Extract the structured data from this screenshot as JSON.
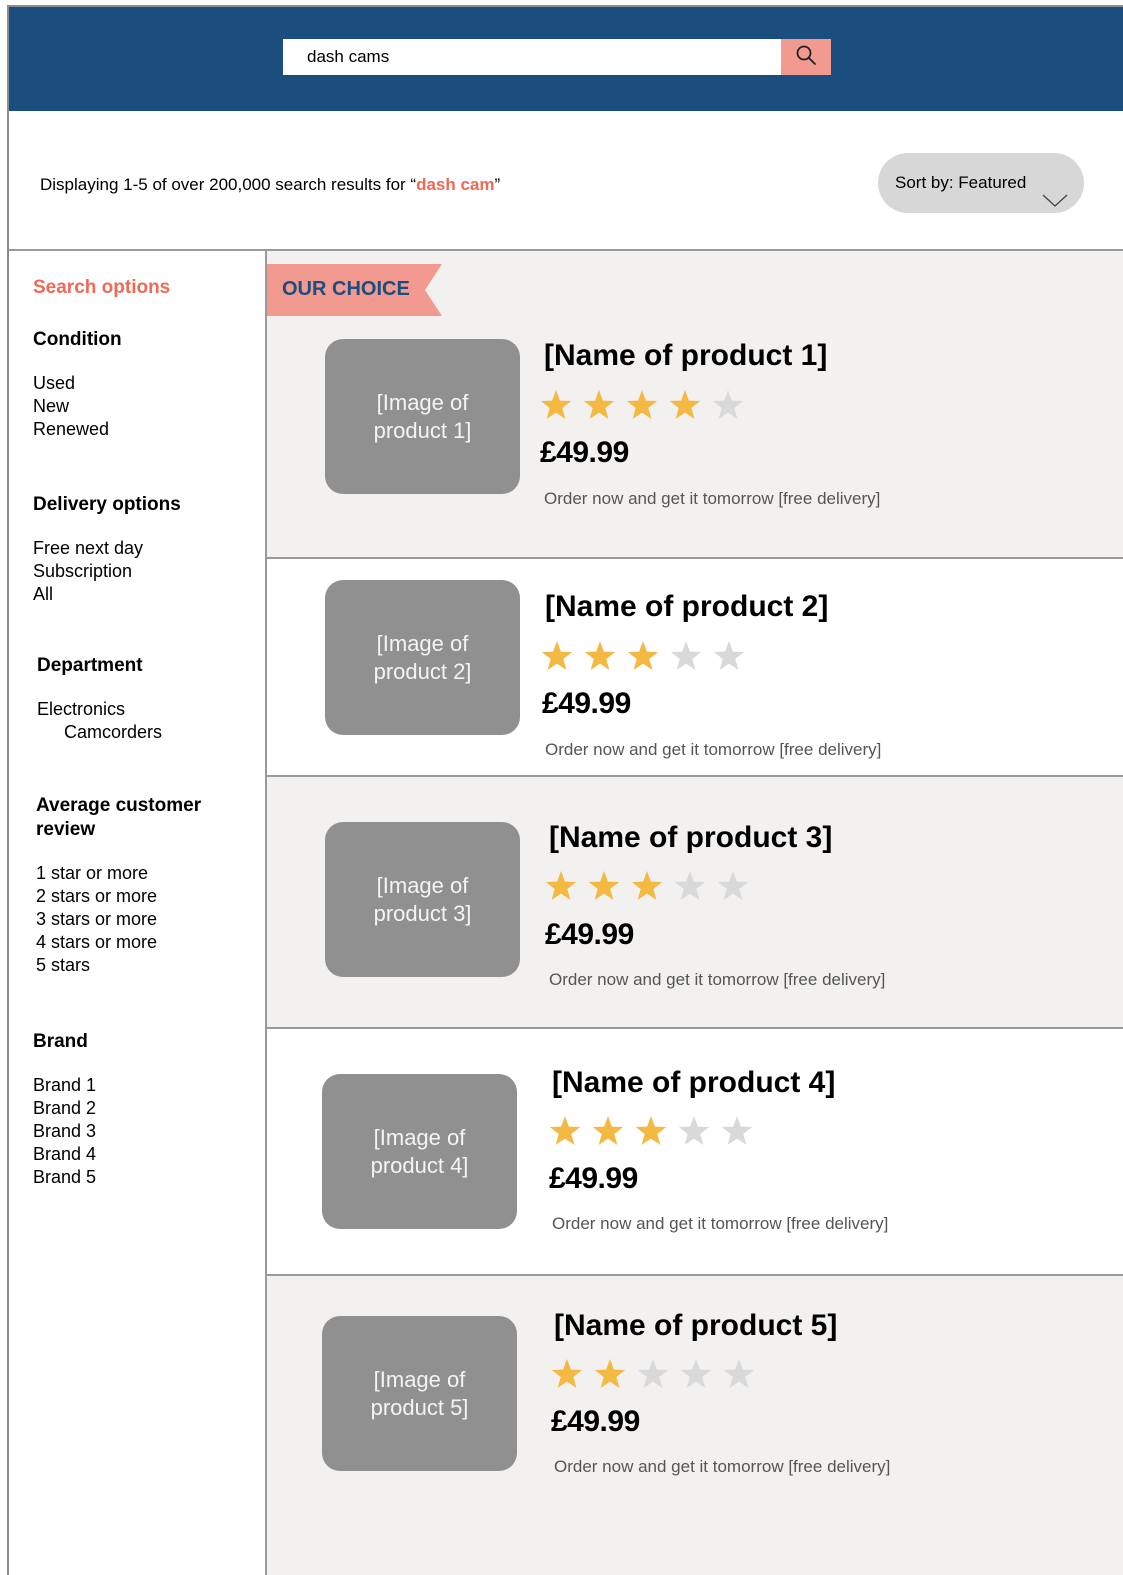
{
  "search": {
    "value": "dash cams"
  },
  "results": {
    "prefix": "Displaying 1-5 of over 200,000 search results for “",
    "query": "dash cam",
    "suffix": "”"
  },
  "sort": {
    "label": "Sort by: Featured"
  },
  "sidebar": {
    "title": "Search options",
    "sections": [
      {
        "heading": "Condition",
        "items": [
          "Used",
          "New",
          "Renewed"
        ]
      },
      {
        "heading": "Delivery options",
        "items": [
          "Free next day",
          "Subscription",
          "All"
        ]
      },
      {
        "heading": "Department",
        "items": [
          "Electronics",
          "Camcorders"
        ]
      },
      {
        "heading_line1": "Average customer",
        "heading_line2": "review",
        "items": [
          "1 star or more",
          "2 stars or more",
          "3 stars or more",
          "4 stars or more",
          "5 stars"
        ]
      },
      {
        "heading": "Brand",
        "items": [
          "Brand 1",
          "Brand 2",
          "Brand 3",
          "Brand 4",
          "Brand 5"
        ]
      }
    ]
  },
  "ribbon": {
    "label": "OUR CHOICE"
  },
  "products": [
    {
      "image_line1": "[Image of",
      "image_line2": "product 1]",
      "name": "[Name of product 1]",
      "rating": 4,
      "max_rating": 5,
      "price": "£49.99",
      "delivery": "Order now and get it tomorrow [free delivery]"
    },
    {
      "image_line1": "[Image of",
      "image_line2": "product 2]",
      "name": "[Name of product 2]",
      "rating": 3,
      "max_rating": 5,
      "price": "£49.99",
      "delivery": "Order now and get it tomorrow [free delivery]"
    },
    {
      "image_line1": "[Image of",
      "image_line2": "product 3]",
      "name": "[Name of product 3]",
      "rating": 3,
      "max_rating": 5,
      "price": "£49.99",
      "delivery": "Order now and get it tomorrow [free delivery]"
    },
    {
      "image_line1": "[Image of",
      "image_line2": "product 4]",
      "name": "[Name of product 4]",
      "rating": 3,
      "max_rating": 5,
      "price": "£49.99",
      "delivery": "Order now and get it tomorrow [free delivery]"
    },
    {
      "image_line1": "[Image of",
      "image_line2": "product 5]",
      "name": "[Name of product 5]",
      "rating": 2,
      "max_rating": 5,
      "price": "£49.99",
      "delivery": "Order now and get it tomorrow [free delivery]"
    }
  ],
  "icons": {
    "search": "search-icon",
    "sort": "chevron-down-icon",
    "star": "star-icon"
  },
  "colors": {
    "header": "#1b4e7f",
    "accent": "#ee6a55",
    "search_button": "#f29a90",
    "star_filled": "#f4b942",
    "star_empty": "#d9d9d9",
    "image_placeholder": "#909090"
  }
}
